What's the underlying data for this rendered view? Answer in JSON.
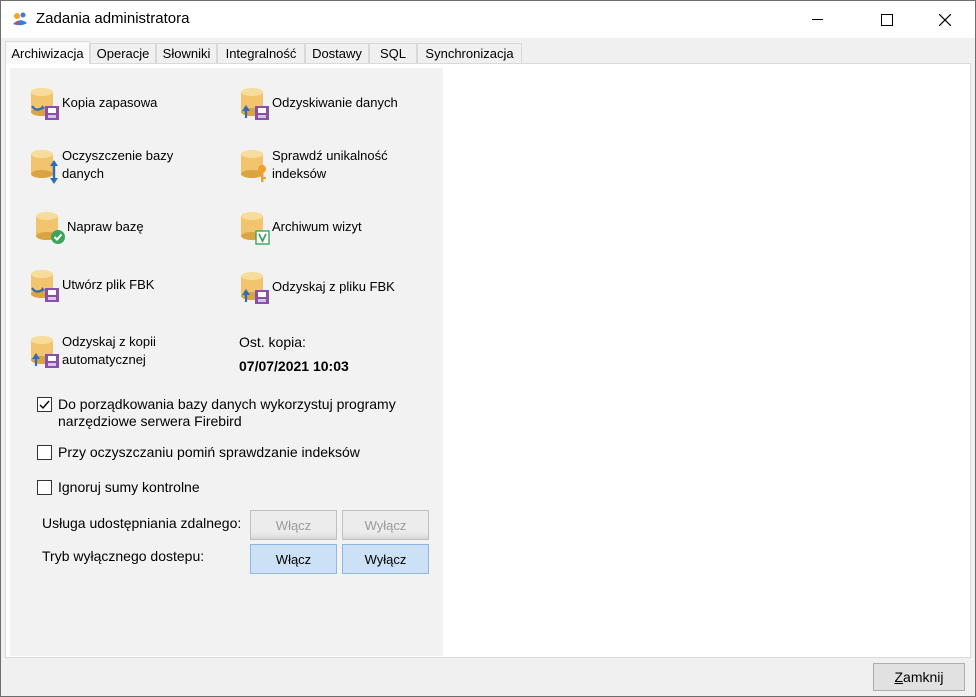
{
  "window": {
    "title": "Zadania administratora"
  },
  "tabs": [
    {
      "label": "Archiwizacja",
      "active": true
    },
    {
      "label": "Operacje"
    },
    {
      "label": "Słowniki"
    },
    {
      "label": "Integralność"
    },
    {
      "label": "Dostawy"
    },
    {
      "label": "SQL"
    },
    {
      "label": "Synchronizacja"
    }
  ],
  "actions": {
    "backup": "Kopia zapasowa",
    "recover": "Odzyskiwanie danych",
    "clean_db": "Oczyszczenie bazy\ndanych",
    "check_index": "Sprawdź unikalność\nindeksów",
    "repair_db": "Napraw bazę",
    "visit_archive": "Archiwum wizyt",
    "create_fbk": "Utwórz plik FBK",
    "recover_fbk": "Odzyskaj z pliku FBK",
    "recover_auto": "Odzyskaj z kopii\nautomatycznej"
  },
  "last_backup": {
    "label": "Ost. kopia:",
    "value": "07/07/2021 10:03"
  },
  "options": [
    {
      "label": "Do porządkowania bazy danych wykorzystuj programy\nnarzędziowe serwera Firebird",
      "checked": true
    },
    {
      "label": "Przy oczyszczaniu pomiń sprawdzanie indeksów",
      "checked": false
    },
    {
      "label": "Ignoruj sumy kontrolne",
      "checked": false
    }
  ],
  "remote_service": {
    "label": "Usługa udostępniania zdalnego:",
    "on": "Włącz",
    "off": "Wyłącz"
  },
  "exclusive_mode": {
    "label": "Tryb wyłącznego dostepu:",
    "on": "Włącz",
    "off": "Wyłącz"
  },
  "footer": {
    "close_first": "Z",
    "close_rest": "amknij"
  },
  "colors": {
    "db_yellow": "#f2c46d",
    "db_dark": "#d9a441",
    "purple": "#8a4fa8",
    "blue_arrow": "#2e6db4",
    "green": "#3aa55b",
    "orange": "#f0a030"
  }
}
